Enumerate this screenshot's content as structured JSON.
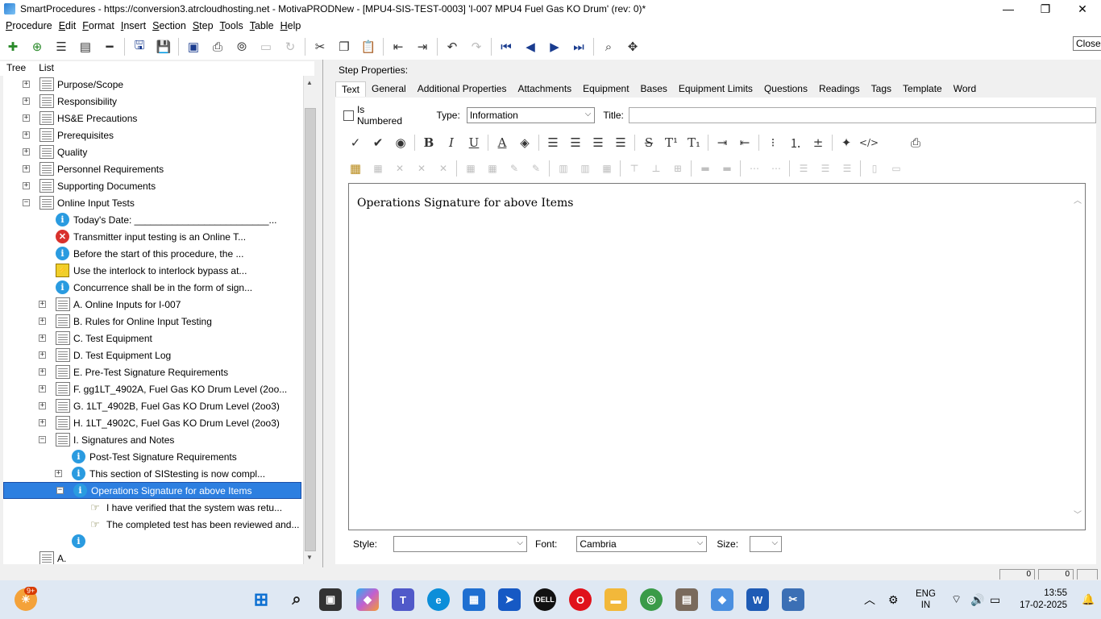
{
  "window": {
    "title": "SmartProcedures - https://conversion3.atrcloudhosting.net - MotivaPRODNew - [MPU4-SIS-TEST-0003] 'I-007 MPU4 Fuel Gas KO Drum' (rev: 0)*",
    "minimize": "—",
    "maximize": "❐",
    "close": "✕"
  },
  "menu": [
    "Procedure",
    "Edit",
    "Format",
    "Insert",
    "Section",
    "Step",
    "Tools",
    "Table",
    "Help"
  ],
  "tooltip": "Close",
  "left_tabs": [
    "Tree",
    "List"
  ],
  "tree": [
    {
      "label": "Purpose/Scope",
      "icon": "doc-icon",
      "exp": "+",
      "depth": 0
    },
    {
      "label": "Responsibility",
      "icon": "doc-icon",
      "exp": "+",
      "depth": 0
    },
    {
      "label": "HS&E Precautions",
      "icon": "doc-icon",
      "exp": "+",
      "depth": 0
    },
    {
      "label": "Prerequisites",
      "icon": "doc-icon",
      "exp": "+",
      "depth": 0
    },
    {
      "label": "Quality",
      "icon": "doc-icon",
      "exp": "+",
      "depth": 0
    },
    {
      "label": "Personnel Requirements",
      "icon": "doc-icon",
      "exp": "+",
      "depth": 0
    },
    {
      "label": "Supporting Documents",
      "icon": "doc-icon",
      "exp": "+",
      "depth": 0
    },
    {
      "label": "Online Input Tests",
      "icon": "doc-icon",
      "exp": "−",
      "depth": 0
    },
    {
      "label": "Today's Date: _________________________...",
      "icon": "info-icon",
      "exp": "",
      "depth": 1
    },
    {
      "label": "Transmitter input testing is an Online T...",
      "icon": "error-icon",
      "exp": "",
      "depth": 1
    },
    {
      "label": "Before the start of this procedure, the ...",
      "icon": "info-icon",
      "exp": "",
      "depth": 1
    },
    {
      "label": "Use the interlock to interlock bypass at...",
      "icon": "warning-icon",
      "exp": "",
      "depth": 1
    },
    {
      "label": "Concurrence shall be in the form of sign...",
      "icon": "info-icon",
      "exp": "",
      "depth": 1
    },
    {
      "label": "A. Online Inputs for I-007",
      "icon": "doc-icon",
      "exp": "+",
      "depth": 1
    },
    {
      "label": "B. Rules for Online Input Testing",
      "icon": "doc-icon",
      "exp": "+",
      "depth": 1
    },
    {
      "label": "C. Test Equipment",
      "icon": "doc-icon",
      "exp": "+",
      "depth": 1
    },
    {
      "label": "D. Test Equipment Log",
      "icon": "doc-icon",
      "exp": "+",
      "depth": 1
    },
    {
      "label": "E. Pre-Test Signature Requirements",
      "icon": "doc-icon",
      "exp": "+",
      "depth": 1
    },
    {
      "label": "F. gg1LT_4902A, Fuel Gas KO Drum Level (2oo...",
      "icon": "doc-icon",
      "exp": "+",
      "depth": 1
    },
    {
      "label": "G. 1LT_4902B, Fuel Gas KO Drum Level (2oo3)",
      "icon": "doc-icon",
      "exp": "+",
      "depth": 1
    },
    {
      "label": "H. 1LT_4902C, Fuel Gas KO Drum Level (2oo3)",
      "icon": "doc-icon",
      "exp": "+",
      "depth": 1
    },
    {
      "label": "I. Signatures and Notes",
      "icon": "doc-icon",
      "exp": "−",
      "depth": 1
    },
    {
      "label": "Post-Test Signature Requirements",
      "icon": "info-icon",
      "exp": "",
      "depth": 2
    },
    {
      "label": "This section of SIStesting is now compl...",
      "icon": "info-icon",
      "exp": "+",
      "depth": 2
    },
    {
      "label": "Operations Signature for above Items",
      "icon": "info-icon",
      "exp": "−",
      "depth": 2,
      "selected": true
    },
    {
      "label": "I have verified that the system was retu...",
      "icon": "hand-icon",
      "exp": "",
      "depth": 3
    },
    {
      "label": "The completed test has been reviewed and...",
      "icon": "hand-icon",
      "exp": "",
      "depth": 3
    },
    {
      "label": "",
      "icon": "info-icon",
      "exp": "",
      "depth": 2
    },
    {
      "label": "A.",
      "icon": "doc-icon",
      "exp": "",
      "depth": 0
    }
  ],
  "right": {
    "heading": "Step Properties:",
    "tabs": [
      "Text",
      "General",
      "Additional Properties",
      "Attachments",
      "Equipment",
      "Bases",
      "Equipment Limits",
      "Questions",
      "Readings",
      "Tags",
      "Template",
      "Word"
    ],
    "is_numbered_label": "Is Numbered",
    "type_label": "Type:",
    "type_value": "Information",
    "title_label": "Title:",
    "title_value": "",
    "editor_text": "Operations Signature for above Items",
    "style_label": "Style:",
    "style_value": "",
    "font_label": "Font:",
    "font_value": "Cambria",
    "size_label": "Size:",
    "size_value": ""
  },
  "status": {
    "box1": "0",
    "box2": "0"
  },
  "taskbar": {
    "badge": "9+",
    "lang": "ENG",
    "region": "IN",
    "time": "13:55",
    "date": "17-02-2025"
  }
}
